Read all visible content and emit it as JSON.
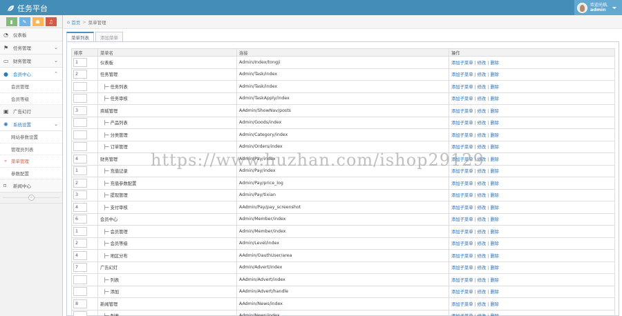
{
  "app": {
    "title": "任务平台",
    "brand_color": "#438eb9"
  },
  "user": {
    "greeting": "欢迎光临,",
    "name": "admin"
  },
  "shortcuts": [
    {
      "icon": "signal-icon",
      "glyph": "▮",
      "color": "#87b87f"
    },
    {
      "icon": "pencil-icon",
      "glyph": "✎",
      "color": "#6fb3e0"
    },
    {
      "icon": "users-icon",
      "glyph": "☗",
      "color": "#ffb752"
    },
    {
      "icon": "bell-icon",
      "glyph": "♫",
      "color": "#d15b47"
    }
  ],
  "sidebar": {
    "dashboard": "仪表板",
    "task_mgmt": "任务管理",
    "finance_mgmt": "财务管理",
    "member_center": "会员中心",
    "member_sub": [
      "会员管理",
      "会员等级"
    ],
    "ads": "广告幻灯",
    "system": "系统设置",
    "system_sub": [
      "网站参数设置",
      "管理员列表",
      "菜单管理",
      "参数配置"
    ],
    "news": "新闻中心"
  },
  "breadcrumb": {
    "home": "首页",
    "current": "菜单管理"
  },
  "tabs": [
    "菜单列表",
    "添加菜单"
  ],
  "table": {
    "headers": [
      "排序",
      "菜单名",
      "连接",
      "操作"
    ],
    "ops": {
      "add_child": "添加子菜单",
      "edit": "修改",
      "delete": "删除"
    },
    "rows": [
      {
        "sort": "1",
        "name": "仪表板",
        "child": false,
        "link": "Admin/Index/tongji"
      },
      {
        "sort": "2",
        "name": "任务管理",
        "child": false,
        "link": "Admin/Task/index"
      },
      {
        "sort": "",
        "name": "├─ 任务列表",
        "child": true,
        "link": "Admin/Task/index"
      },
      {
        "sort": "",
        "name": "├─ 任务审核",
        "child": true,
        "link": "Admin/TaskApply/index"
      },
      {
        "sort": "3",
        "name": "商城管理",
        "child": false,
        "link": "AAdmin/ShowNav/posts"
      },
      {
        "sort": "",
        "name": "├─ 产品列表",
        "child": true,
        "link": "Admin/Goods/index"
      },
      {
        "sort": "",
        "name": "├─ 分类管理",
        "child": true,
        "link": "Admin/Category/index"
      },
      {
        "sort": "",
        "name": "├─ 订单管理",
        "child": true,
        "link": "Admin/Orders/index"
      },
      {
        "sort": "4",
        "name": "财务管理",
        "child": false,
        "link": "Admin/Pay/index"
      },
      {
        "sort": "1",
        "name": "├─ 充值记录",
        "child": true,
        "link": "Admin/Pay/index"
      },
      {
        "sort": "2",
        "name": "├─ 充值参数配置",
        "child": true,
        "link": "Admin/Pay/price_log"
      },
      {
        "sort": "3",
        "name": "├─ 提现管理",
        "child": true,
        "link": "Admin/Pay/tixian"
      },
      {
        "sort": "4",
        "name": "├─ 支付审核",
        "child": true,
        "link": "AAdmin/Pay/pay_screenshot"
      },
      {
        "sort": "6",
        "name": "会员中心",
        "child": false,
        "link": "Admin/Member/index"
      },
      {
        "sort": "1",
        "name": "├─ 会员管理",
        "child": true,
        "link": "Admin/Member/index"
      },
      {
        "sort": "2",
        "name": "├─ 会员等级",
        "child": true,
        "link": "Admin/Level/index"
      },
      {
        "sort": "4",
        "name": "├─ 地区分布",
        "child": true,
        "link": "AAdmin/OauthUser/area"
      },
      {
        "sort": "7",
        "name": "广告幻灯",
        "child": false,
        "link": "Admin/Advert/index"
      },
      {
        "sort": "",
        "name": "├─ 列表",
        "child": true,
        "link": "AAdmin/Advert/index"
      },
      {
        "sort": "",
        "name": "├─ 添加",
        "child": true,
        "link": "AAdmin/Advert/handle"
      },
      {
        "sort": "8",
        "name": "新闻管理",
        "child": false,
        "link": "AAdmin/News/index"
      },
      {
        "sort": "",
        "name": "├─ 列表",
        "child": true,
        "link": "Admin/News/index"
      }
    ]
  },
  "watermark": "https://www.huzhan.com/ishop29129"
}
